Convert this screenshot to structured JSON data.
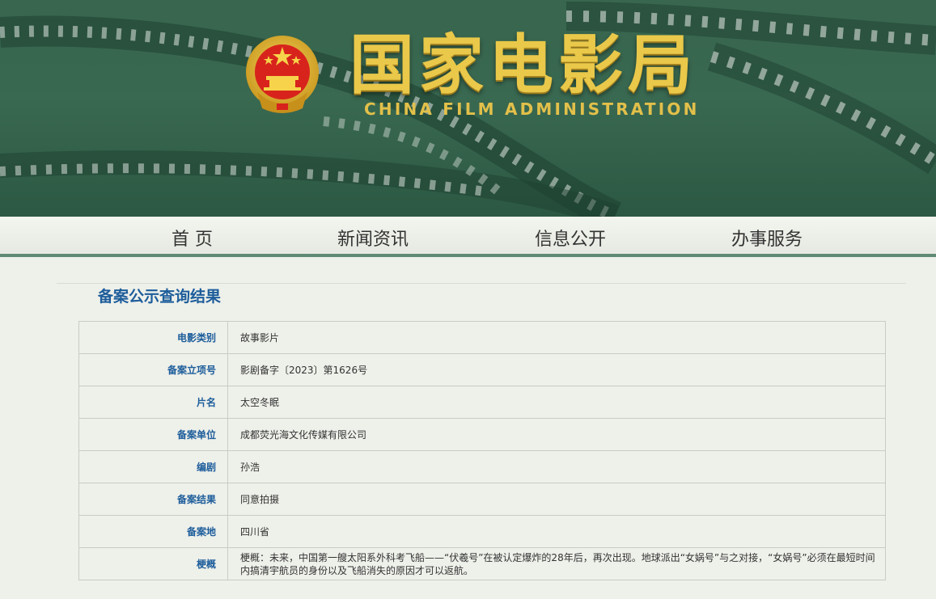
{
  "header": {
    "title_cn": "国家电影局",
    "title_en": "CHINA FILM ADMINISTRATION",
    "logo_icon": "national-emblem-icon"
  },
  "nav": {
    "items": [
      {
        "label": "首 页"
      },
      {
        "label": "新闻资讯"
      },
      {
        "label": "信息公开"
      },
      {
        "label": "办事服务"
      }
    ]
  },
  "result": {
    "title": "备案公示查询结果",
    "rows": [
      {
        "key": "电影类别",
        "value": "故事影片"
      },
      {
        "key": "备案立项号",
        "value": "影剧备字〔2023〕第1626号"
      },
      {
        "key": "片名",
        "value": "太空冬眠"
      },
      {
        "key": "备案单位",
        "value": "成都荧光海文化传媒有限公司"
      },
      {
        "key": "编剧",
        "value": "孙浩"
      },
      {
        "key": "备案结果",
        "value": "同意拍摄"
      },
      {
        "key": "备案地",
        "value": "四川省"
      },
      {
        "key": "梗概",
        "value": "梗概：未来，中国第一艘太阳系外科考飞船——“伏羲号”在被认定爆炸的28年后，再次出现。地球派出“女娲号”与之对接，“女娲号”必须在最短时间内搞清宇航员的身份以及飞船消失的原因才可以返航。"
      }
    ]
  },
  "colors": {
    "banner_green": "#2d5a43",
    "gold": "#e9c84a",
    "accent_blue": "#1d5d9b",
    "nav_border": "#5f8a73"
  }
}
